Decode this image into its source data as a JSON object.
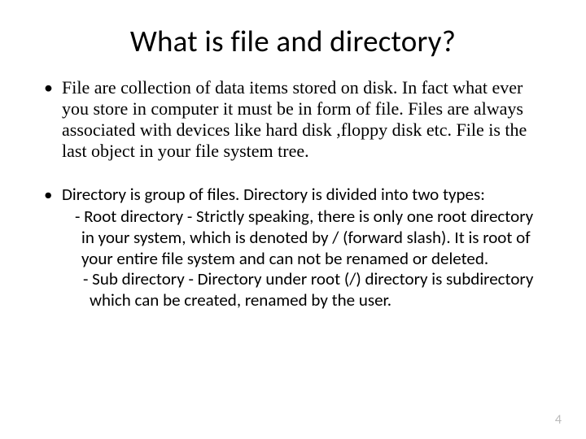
{
  "slide": {
    "title": "What is file and directory?",
    "bullet1": "File are collection of data items stored on disk. In fact what ever you store in computer it must be in form of file. Files are always associated with devices like hard disk ,floppy disk etc. File is the last object in your file system tree.",
    "bullet2": "Directory is group of files. Directory is divided into two types:",
    "sub1": "- Root directory - Strictly speaking, there is only one root directory in your system, which is denoted by / (forward slash). It is root of your entire file system and can not be renamed or deleted.",
    "sub2": "- Sub directory - Directory under root (/) directory is subdirectory which can be created, renamed by the user.",
    "page_number": "4"
  }
}
